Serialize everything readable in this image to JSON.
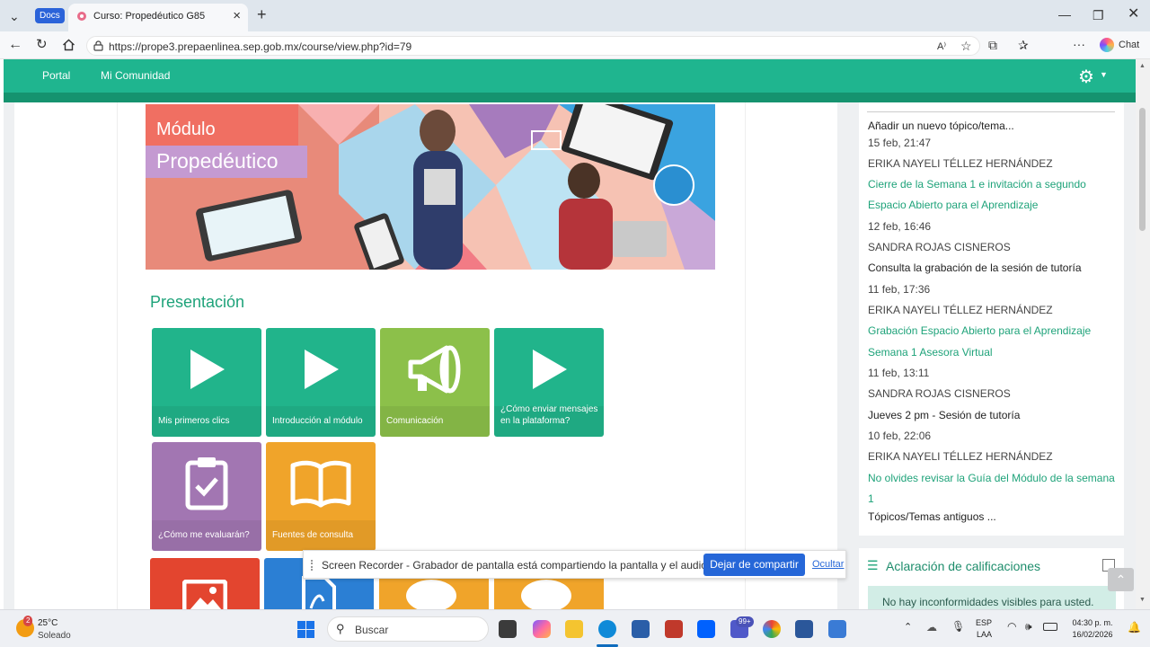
{
  "browser": {
    "docs_label": "Docs",
    "tab_title": "Curso: Propedéutico G85",
    "url": "https://prope3.prepaenlinea.sep.gob.mx/course/view.php?id=79",
    "chat_label": "Chat"
  },
  "nav": {
    "items": [
      "Portal",
      "Mi Comunidad"
    ]
  },
  "banner": {
    "title1": "Módulo",
    "title2": "Propedéutico"
  },
  "section": {
    "title": "Presentación"
  },
  "tiles": [
    {
      "label": "Mis primeros clics",
      "color": "#21b48b",
      "icon": "play-icon"
    },
    {
      "label": "Introducción al módulo",
      "color": "#21b48b",
      "icon": "play-icon"
    },
    {
      "label": "Comunicación",
      "color": "#8cc04a",
      "icon": "megaphone-icon"
    },
    {
      "label": "¿Cómo enviar mensajes en la plataforma?",
      "color": "#21b48b",
      "icon": "play-icon"
    },
    {
      "label": "¿Cómo me evaluarán?",
      "color": "#a276b2",
      "icon": "clipboard-check-icon"
    },
    {
      "label": "Fuentes de consulta",
      "color": "#f0a42a",
      "icon": "book-icon"
    }
  ],
  "bottom_tiles_colors": [
    "#e3452f",
    "#2b7fd4",
    "#f0a42a",
    "#f0a42a"
  ],
  "news": {
    "items": [
      {
        "text": "Añadir un nuevo tópico/tema...",
        "kind": "action"
      },
      {
        "text": "15 feb, 21:47",
        "kind": "meta"
      },
      {
        "text": "ERIKA NAYELI TÉLLEZ HERNÁNDEZ",
        "kind": "author"
      },
      {
        "text": "Cierre de la Semana 1 e invitación a segundo",
        "kind": "link"
      },
      {
        "text": "Espacio Abierto para el Aprendizaje",
        "kind": "link"
      },
      {
        "text": "12 feb, 16:46",
        "kind": "meta"
      },
      {
        "text": "SANDRA ROJAS CISNEROS",
        "kind": "author"
      },
      {
        "text": "Consulta la grabación de la sesión de tutoría",
        "kind": "title"
      },
      {
        "text": "11 feb, 17:36",
        "kind": "meta"
      },
      {
        "text": "ERIKA NAYELI TÉLLEZ HERNÁNDEZ",
        "kind": "author"
      },
      {
        "text": "Grabación Espacio Abierto para el Aprendizaje",
        "kind": "link"
      },
      {
        "text": "Semana 1 Asesora Virtual",
        "kind": "link"
      },
      {
        "text": "11 feb, 13:11",
        "kind": "meta"
      },
      {
        "text": "SANDRA ROJAS CISNEROS",
        "kind": "author"
      },
      {
        "text": "Jueves 2 pm - Sesión de tutoría",
        "kind": "title"
      },
      {
        "text": "10 feb, 22:06",
        "kind": "meta"
      },
      {
        "text": "ERIKA NAYELI TÉLLEZ HERNÁNDEZ",
        "kind": "author"
      },
      {
        "text": "No olvides revisar la Guía del Módulo de la semana",
        "kind": "link"
      },
      {
        "text": "1",
        "kind": "link"
      },
      {
        "text": "Tópicos/Temas antiguos ...",
        "kind": "action"
      }
    ]
  },
  "grades": {
    "title": "Aclaración de calificaciones",
    "message": "No hay inconformidades visibles para usted."
  },
  "share": {
    "message": "Screen Recorder - Grabador de pantalla está compartiendo la pantalla y el audio.",
    "stop_label": "Dejar de compartir",
    "hide_label": "Ocultar"
  },
  "taskbar": {
    "weather_badge": "2",
    "temperature": "25°C",
    "weather": "Soleado",
    "search_placeholder": "Buscar",
    "teams_badge": "99+",
    "lang1": "ESP",
    "lang2": "LAA",
    "time": "04:30 p. m.",
    "date": "16/02/2026"
  },
  "colors": {
    "brand": "#1fb58f",
    "link": "#1fa37a"
  }
}
